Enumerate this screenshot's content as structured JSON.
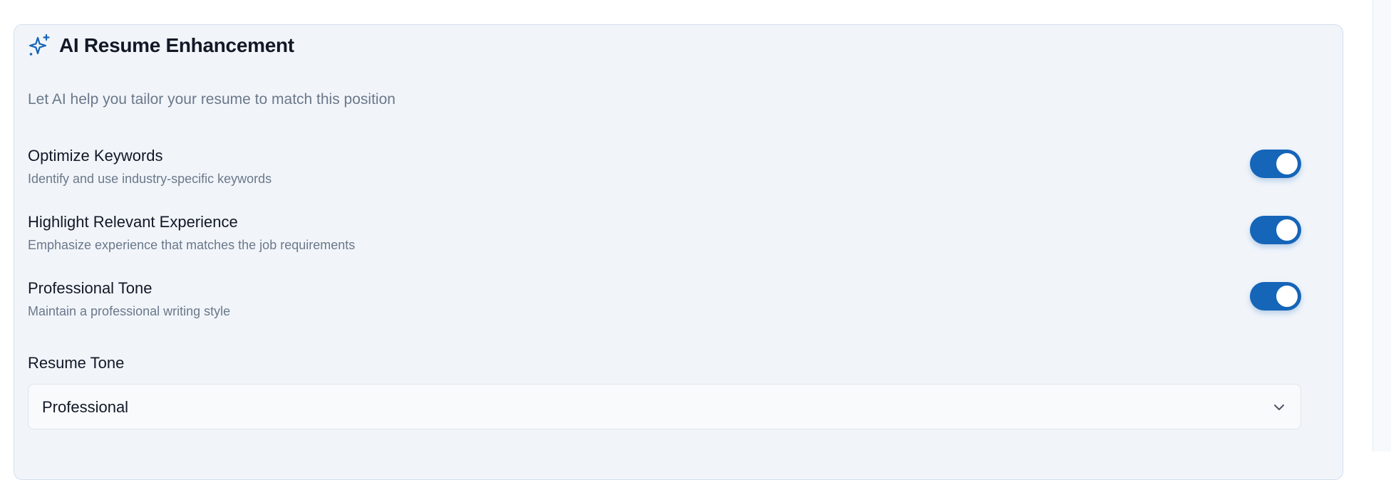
{
  "panel": {
    "title": "AI Resume Enhancement",
    "subtitle": "Let AI help you tailor your resume to match this position",
    "icon": "sparkle-icon",
    "accent_color": "#1565b8"
  },
  "options": [
    {
      "label": "Optimize Keywords",
      "description": "Identify and use industry-specific keywords",
      "enabled": true
    },
    {
      "label": "Highlight Relevant Experience",
      "description": "Emphasize experience that matches the job requirements",
      "enabled": true
    },
    {
      "label": "Professional Tone",
      "description": "Maintain a professional writing style",
      "enabled": true
    }
  ],
  "resume_tone": {
    "label": "Resume Tone",
    "selected": "Professional",
    "icon": "chevron-down-icon"
  }
}
